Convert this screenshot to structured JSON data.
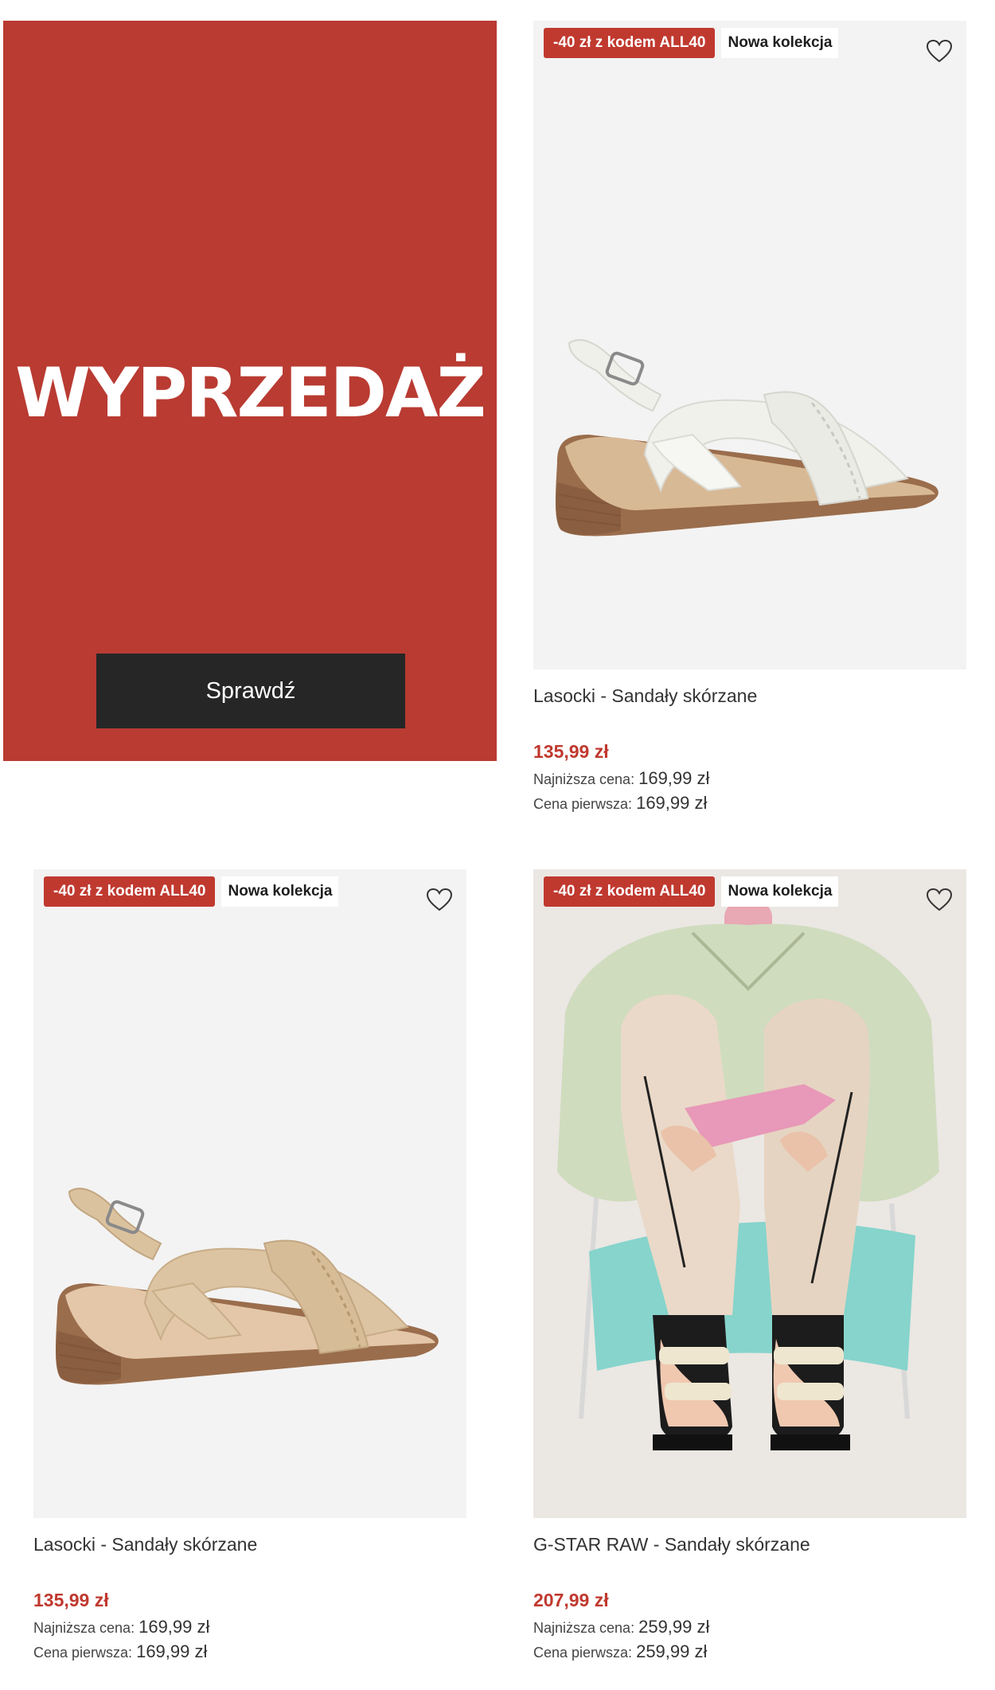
{
  "promo": {
    "title": "WYPRZEDAŻ",
    "button_label": "Sprawdź",
    "background_color": "#b93b32"
  },
  "products": [
    {
      "promo_badge": "-40 zł z kodem ALL40",
      "new_badge": "Nowa kolekcja",
      "name": "Lasocki - Sandały skórzane",
      "price": "135,99 zł",
      "lowest_label": "Najniższa cena:",
      "lowest_value": "169,99 zł",
      "first_label": "Cena pierwsza:",
      "first_value": "169,99 zł",
      "image_icon": "white-wedge-sandal-image"
    },
    {
      "promo_badge": "-40 zł z kodem ALL40",
      "new_badge": "Nowa kolekcja",
      "name": "Lasocki - Sandały skórzane",
      "price": "135,99 zł",
      "lowest_label": "Najniższa cena:",
      "lowest_value": "169,99 zł",
      "first_label": "Cena pierwsza:",
      "first_value": "169,99 zł",
      "image_icon": "beige-wedge-sandal-image"
    },
    {
      "promo_badge": "-40 zł z kodem ALL40",
      "new_badge": "Nowa kolekcja",
      "name": "G-STAR RAW - Sandały skórzane",
      "price": "207,99 zł",
      "lowest_label": "Najniższa cena:",
      "lowest_value": "259,99 zł",
      "first_label": "Cena pierwsza:",
      "first_value": "259,99 zł",
      "image_icon": "model-wearing-sandals-image"
    }
  ],
  "colors": {
    "accent_red": "#c0392f",
    "button_dark": "#262626"
  }
}
